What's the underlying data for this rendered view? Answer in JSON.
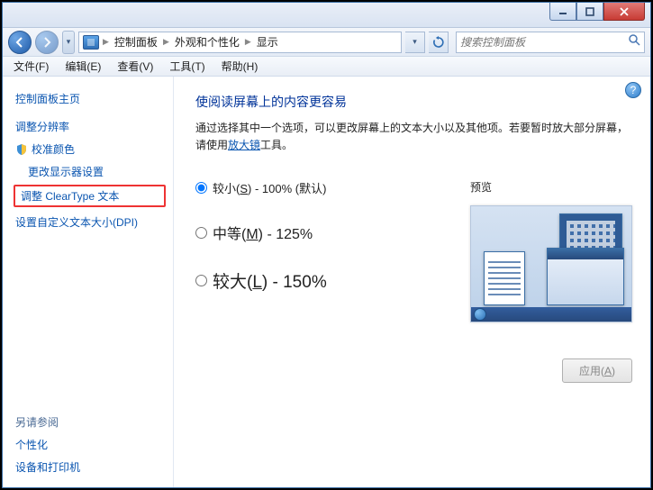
{
  "titlebar": {},
  "nav": {
    "crumb1": "控制面板",
    "crumb2": "外观和个性化",
    "crumb3": "显示",
    "search_placeholder": "搜索控制面板"
  },
  "menu": {
    "file": "文件(F)",
    "edit": "编辑(E)",
    "view": "查看(V)",
    "tools": "工具(T)",
    "help": "帮助(H)"
  },
  "sidebar": {
    "home": "控制面板主页",
    "resolution": "调整分辨率",
    "calibrate": "校准颜色",
    "display_settings": "更改显示器设置",
    "cleartype": "调整 ClearType 文本",
    "dpi": "设置自定义文本大小(DPI)",
    "see_also": "另请参阅",
    "personalization": "个性化",
    "devices": "设备和打印机"
  },
  "main": {
    "heading": "使阅读屏幕上的内容更容易",
    "desc_prefix": "通过选择其中一个选项，可以更改屏幕上的文本大小以及其他项。若要暂时放大部分屏幕，请使用",
    "desc_link": "放大镜",
    "desc_suffix": "工具。",
    "opt_small_pre": "较小(",
    "opt_small_u": "S",
    "opt_small_post": ") - 100% (默认)",
    "opt_med_pre": "中等(",
    "opt_med_u": "M",
    "opt_med_post": ") - 125%",
    "opt_large_pre": "较大(",
    "opt_large_u": "L",
    "opt_large_post": ") - 150%",
    "preview": "预览",
    "apply_pre": "应用(",
    "apply_u": "A",
    "apply_post": ")"
  }
}
